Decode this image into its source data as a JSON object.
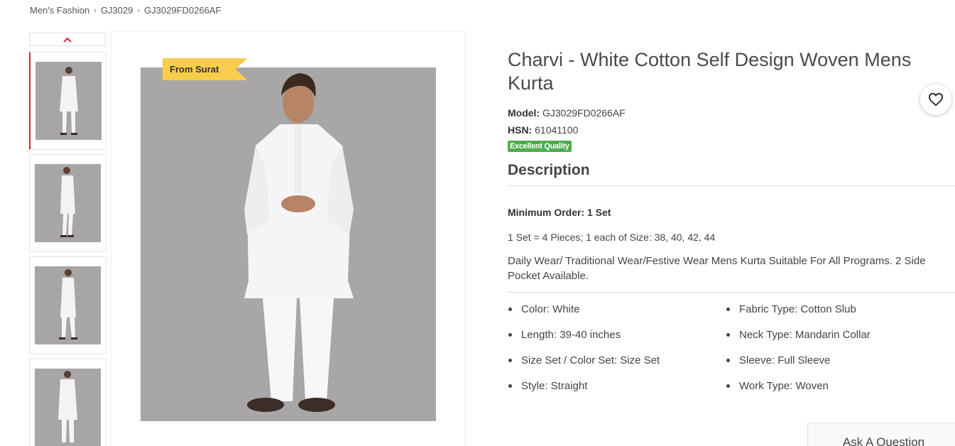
{
  "breadcrumb": [
    {
      "label": "Men's Fashion"
    },
    {
      "label": "GJ3029"
    },
    {
      "label": "GJ3029FD0266AF"
    }
  ],
  "badge": "From Surat",
  "product": {
    "title": "Charvi - White Cotton Self Design Woven Mens Kurta",
    "model_label": "Model:",
    "model_value": "GJ3029FD0266AF",
    "hsn_label": "HSN:",
    "hsn_value": "61041100",
    "quality_badge": "Excellent Quality"
  },
  "description": {
    "heading": "Description",
    "min_order": "Minimum Order: 1 Set",
    "set_info": "1 Set = 4 Pieces; 1 each of Size: 38, 40, 42, 44",
    "text": "Daily Wear/ Traditional Wear/Festive Wear Mens Kurta Suitable For All Programs. 2 Side Pocket Available.",
    "specs": [
      "Color: White",
      "Fabric Type: Cotton Slub",
      "Length: 39-40 inches",
      "Neck Type: Mandarin Collar",
      "Size Set / Color Set: Size Set",
      "Sleeve: Full Sleeve",
      "Style: Straight",
      "Work Type: Woven"
    ]
  },
  "actions": {
    "ask_question": "Ask A Question"
  },
  "colors": {
    "accent_red": "#e0243a",
    "badge_yellow": "#f6cd4d",
    "quality_green": "#4cae4c"
  },
  "icons": [
    "chevron-up-icon",
    "heart-icon"
  ]
}
